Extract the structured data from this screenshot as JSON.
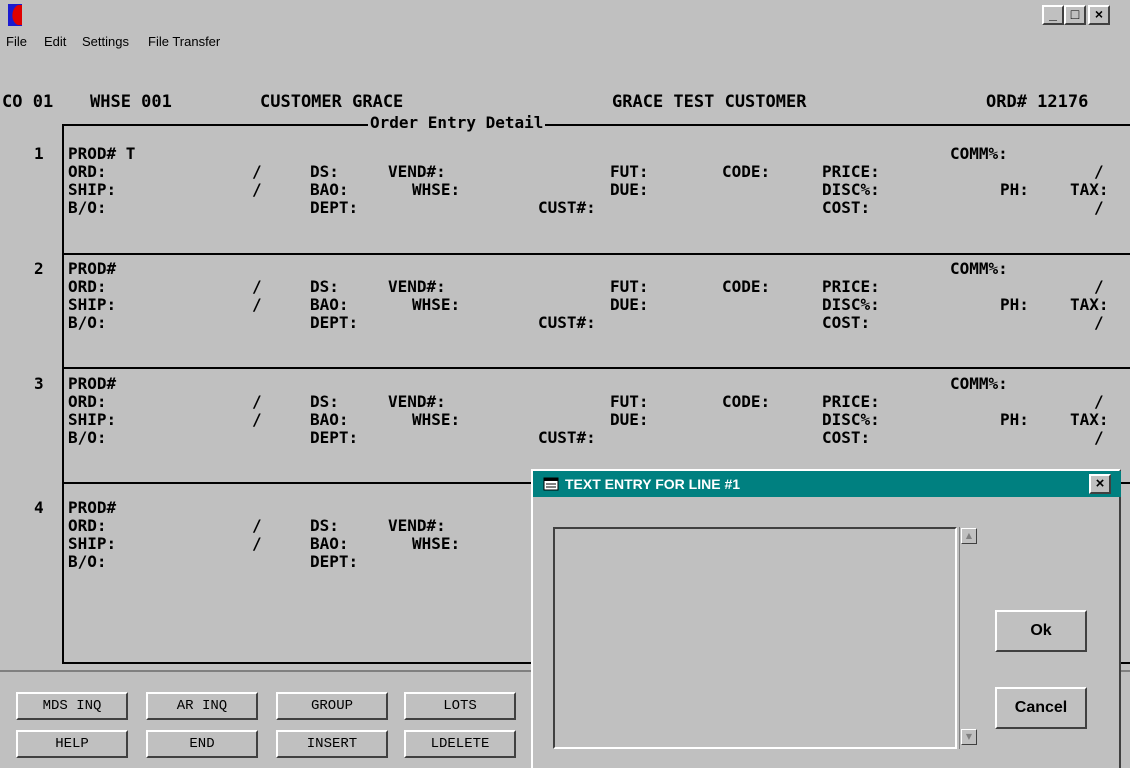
{
  "window": {
    "minimize": "_",
    "maximize": "□",
    "close": "×"
  },
  "menu": [
    "File",
    "Edit",
    "Settings",
    "File Transfer"
  ],
  "header": {
    "co": "CO 01",
    "whse": "WHSE 001",
    "customer_label": "CUSTOMER GRACE",
    "customer_name": "GRACE TEST CUSTOMER",
    "order": "ORD# 12176",
    "subtitle": "Order Entry Detail"
  },
  "lines": [
    {
      "num": "1",
      "prod": "PROD# T"
    },
    {
      "num": "2",
      "prod": "PROD#"
    },
    {
      "num": "3",
      "prod": "PROD#"
    },
    {
      "num": "4",
      "prod": "PROD#"
    }
  ],
  "labels": {
    "ord": "ORD:",
    "ship": "SHIP:",
    "bo": "B/O:",
    "ds": "DS:",
    "bao": "BAO:",
    "dept": "DEPT:",
    "vend": "VEND#:",
    "whse": "WHSE:",
    "cust": "CUST#:",
    "fut": "FUT:",
    "due": "DUE:",
    "code": "CODE:",
    "price": "PRICE:",
    "disc": "DISC%:",
    "cost": "COST:",
    "comm": "COMM%:",
    "ph": "PH:",
    "tax": "TAX:",
    "slash": "/"
  },
  "fkeys": {
    "mds_inq": "MDS INQ",
    "ar_inq": "AR INQ",
    "group": "GROUP",
    "lots": "LOTS",
    "help": "HELP",
    "end": "END",
    "insert": "INSERT",
    "ldelete": "LDELETE"
  },
  "dialog": {
    "title": "TEXT ENTRY FOR LINE #1",
    "close": "×",
    "text_value": "",
    "ok": "Ok",
    "cancel": "Cancel",
    "scroll_up": "▲",
    "scroll_down": "▼"
  }
}
